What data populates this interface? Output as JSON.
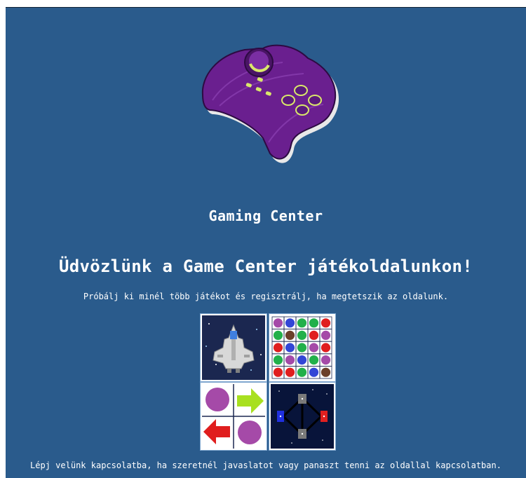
{
  "header": {
    "logo_icon": "gamepad-icon",
    "site_title": "Gaming Center"
  },
  "main": {
    "welcome_heading": "Üdvözlünk a Game Center játékoldalunkon!",
    "intro_text": "Próbálj ki minél több játékot és regisztrálj, ha megtetszik az oldalunk.",
    "games": [
      {
        "icon": "spaceship-game-icon"
      },
      {
        "icon": "match-colors-game-icon"
      },
      {
        "icon": "arrows-puzzle-game-icon"
      },
      {
        "icon": "pong-space-game-icon"
      }
    ]
  },
  "footer": {
    "contact_text": "Lépj velünk kapcsolatba, ha szeretnél javaslatot vagy panaszt tenni az oldallal kapcsolatban."
  },
  "colors": {
    "page_background": "#2a5b8c",
    "text": "#ffffff",
    "controller_purple": "#6a1f8f",
    "controller_accent": "#d9e86a"
  }
}
